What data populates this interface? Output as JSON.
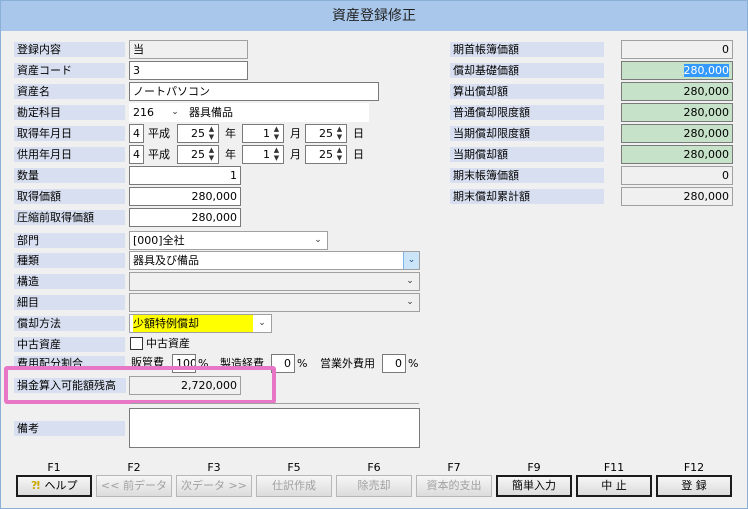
{
  "title": "資産登録修正",
  "left": {
    "touroku_naiyou": {
      "label": "登録内容",
      "value": "当"
    },
    "shisan_code": {
      "label": "資産コード",
      "value": "3"
    },
    "shisan_mei": {
      "label": "資産名",
      "value": "ノートパソコン"
    },
    "kanjou_kamoku": {
      "label": "勘定科目",
      "code": "216",
      "name": "器具備品"
    },
    "shutoku_date": {
      "label": "取得年月日",
      "era_num": "4",
      "era": "平成",
      "year": "25",
      "year_unit": "年",
      "month": "1",
      "month_unit": "月",
      "day": "25",
      "day_unit": "日"
    },
    "kyouyou_date": {
      "label": "供用年月日",
      "era_num": "4",
      "era": "平成",
      "year": "25",
      "year_unit": "年",
      "month": "1",
      "month_unit": "月",
      "day": "25",
      "day_unit": "日"
    },
    "suuryou": {
      "label": "数量",
      "value": "1"
    },
    "shutoku_kagaku": {
      "label": "取得価額",
      "value": "280,000"
    },
    "asshuku_mae": {
      "label": "圧縮前取得価額",
      "value": "280,000"
    },
    "bumon": {
      "label": "部門",
      "value": "[000]全社"
    },
    "shurui": {
      "label": "種類",
      "value": "器具及び備品"
    },
    "kouzou": {
      "label": "構造",
      "value": ""
    },
    "saimoku": {
      "label": "細目",
      "value": ""
    },
    "shoukyaku_houhou": {
      "label": "償却方法",
      "value": "少額特例償却",
      "highlight_color": "#ffff00"
    },
    "chuuko": {
      "label": "中古資産",
      "check_label": "中古資産",
      "checked": false
    },
    "hiyou_haifu": {
      "label": "費用配分割合",
      "hanbai_label": "販管費",
      "hanbai_value": "100",
      "seizou_label": "製造経費",
      "seizou_value": "0",
      "eigyougai_label": "営業外費用",
      "eigyougai_value": "0",
      "percent": "%"
    },
    "songin": {
      "label": "損金算入可能額残高",
      "value": "2,720,000"
    },
    "bikou": {
      "label": "備考",
      "value": ""
    }
  },
  "right": {
    "kisho": {
      "label": "期首帳簿価額",
      "value": "0"
    },
    "shoukyaku_kiso": {
      "label": "償却基礎価額",
      "value": "280,000"
    },
    "sanshutsu": {
      "label": "算出償却額",
      "value": "280,000"
    },
    "futsuu_gendo": {
      "label": "普通償却限度額",
      "value": "280,000"
    },
    "touki_gendo": {
      "label": "当期償却限度額",
      "value": "280,000"
    },
    "touki_shoukyaku": {
      "label": "当期償却額",
      "value": "280,000"
    },
    "kimatsu_boka": {
      "label": "期末帳簿価額",
      "value": "0"
    },
    "kimatsu_ruikei": {
      "label": "期末償却累計額",
      "value": "280,000"
    }
  },
  "fkeys": [
    {
      "key": "F1",
      "label": "ヘルプ",
      "enabled": true
    },
    {
      "key": "F2",
      "label": "<< 前データ",
      "enabled": false
    },
    {
      "key": "F3",
      "label": "次データ >>",
      "enabled": false
    },
    {
      "key": "F5",
      "label": "仕訳作成",
      "enabled": false
    },
    {
      "key": "F6",
      "label": "除売却",
      "enabled": false
    },
    {
      "key": "F7",
      "label": "資本的支出",
      "enabled": false
    },
    {
      "key": "F9",
      "label": "簡単入力",
      "enabled": true
    },
    {
      "key": "F11",
      "label": "中 止",
      "enabled": true
    },
    {
      "key": "F12",
      "label": "登 録",
      "enabled": true
    }
  ],
  "colors": {
    "titlebar": "#a9c7ea",
    "label_bg": "#d8dff0",
    "green_field": "#c6e2c8",
    "highlight_frame": "#e777c6"
  }
}
